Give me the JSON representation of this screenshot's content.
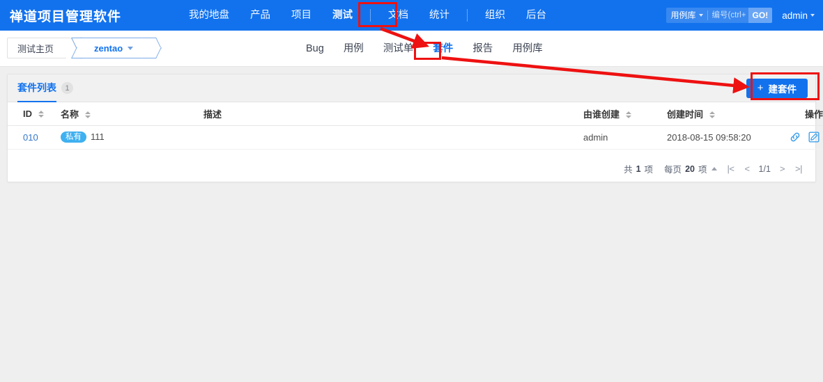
{
  "app": {
    "brand": "禅道项目管理软件",
    "accent_color": "#1272ee",
    "annotation_color": "#ee1111"
  },
  "topnav": {
    "items": [
      {
        "label": "我的地盘",
        "active": false
      },
      {
        "label": "产品",
        "active": false
      },
      {
        "label": "项目",
        "active": false
      },
      {
        "label": "测试",
        "active": true
      },
      {
        "label": "文档",
        "active": false
      },
      {
        "label": "统计",
        "active": false
      },
      {
        "label": "组织",
        "active": false
      },
      {
        "label": "后台",
        "active": false
      }
    ]
  },
  "search": {
    "type_label": "用例库",
    "placeholder": "编号(ctrl+",
    "value": "",
    "go_label": "GO!"
  },
  "user": {
    "name": "admin"
  },
  "breadcrumb": {
    "home": "测试主页",
    "current": "zentao"
  },
  "modnav": {
    "items": [
      {
        "label": "Bug",
        "active": false
      },
      {
        "label": "用例",
        "active": false
      },
      {
        "label": "测试单",
        "active": false
      },
      {
        "label": "套件",
        "active": true
      },
      {
        "label": "报告",
        "active": false
      },
      {
        "label": "用例库",
        "active": false
      }
    ]
  },
  "toolbar": {
    "list_tab_label": "套件列表",
    "list_tab_count": "1",
    "create_label": "建套件",
    "create_plus": "+"
  },
  "table": {
    "headers": [
      {
        "label": "ID",
        "sortable": true
      },
      {
        "label": "名称",
        "sortable": true
      },
      {
        "label": "描述",
        "sortable": false
      },
      {
        "label": "由谁创建",
        "sortable": true
      },
      {
        "label": "创建时间",
        "sortable": true
      },
      {
        "label": "操作",
        "sortable": false
      }
    ],
    "rows": [
      {
        "id": "010",
        "badge": "私有",
        "name": "111",
        "desc": "",
        "created_by": "admin",
        "created_at": "2018-08-15 09:58:20",
        "actions": [
          "link-icon",
          "edit-icon",
          "delete-icon"
        ]
      }
    ]
  },
  "pager": {
    "total_prefix": "共",
    "total_count": "1",
    "total_suffix": "项",
    "perpage_prefix": "每页",
    "perpage_count": "20",
    "perpage_suffix": "项",
    "first": "|<",
    "prev": "<",
    "position": "1/1",
    "next": ">",
    "last": ">|"
  },
  "annotations": {
    "boxes": [
      "测试",
      "套件",
      "建套件"
    ],
    "arrows": 2
  }
}
